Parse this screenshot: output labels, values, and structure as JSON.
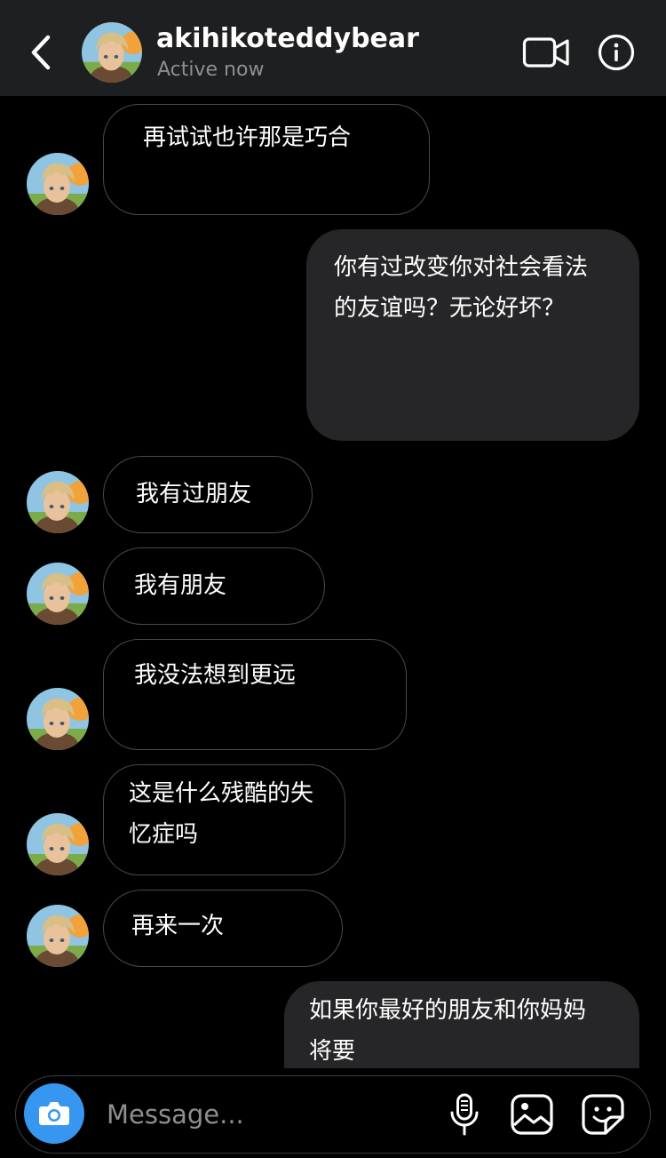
{
  "header": {
    "username": "akihikoteddybear",
    "status": "Active now",
    "icons": {
      "back": "chevron-left-icon",
      "video": "video-camera-icon",
      "info": "info-icon"
    }
  },
  "messages": [
    {
      "from": "them",
      "lines": [
        "再试试也许那是巧合"
      ]
    },
    {
      "from": "me",
      "lines": [
        "你有过改变你对社会看法",
        "的友谊吗？无论好坏？"
      ]
    },
    {
      "from": "them",
      "lines": [
        "我有过朋友"
      ]
    },
    {
      "from": "them",
      "lines": [
        "我有朋友"
      ]
    },
    {
      "from": "them",
      "lines": [
        "我没法想到更远"
      ]
    },
    {
      "from": "them",
      "lines": [
        "这是什么残酷的失",
        "忆症吗"
      ]
    },
    {
      "from": "them",
      "lines": [
        "再来一次"
      ]
    },
    {
      "from": "me",
      "lines": [
        "如果你最好的朋友和你妈妈",
        "将要"
      ]
    }
  ],
  "composer": {
    "placeholder": "Message...",
    "value": "",
    "icons": {
      "camera": "camera-icon",
      "mic": "microphone-icon",
      "gallery": "image-icon",
      "sticker": "sticker-icon"
    }
  },
  "colors": {
    "background": "#000000",
    "header": "#1e1f21",
    "outgoing_bubble": "#262628",
    "incoming_border": "#4a4a4a",
    "camera_accent": "#3797f0",
    "secondary_text": "#8e8e8e"
  }
}
